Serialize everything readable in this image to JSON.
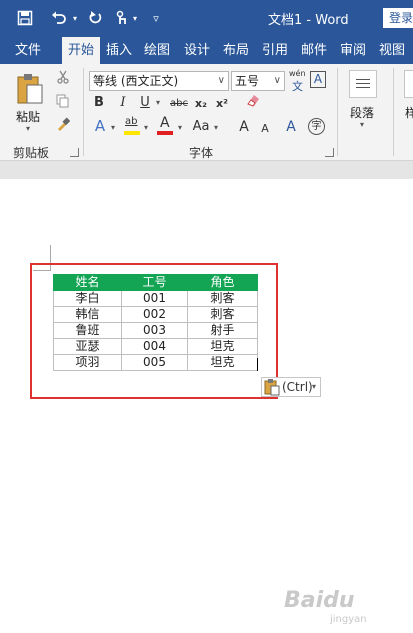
{
  "window": {
    "doc_title": "文档1 - Word",
    "login_label": "登录"
  },
  "qat": {
    "save_icon": "save-icon",
    "undo_icon": "undo-icon",
    "redo_icon": "redo-icon",
    "touch_icon": "touch-mode-icon",
    "customize_icon": "customize-qat-icon"
  },
  "tabs": [
    "文件",
    "开始",
    "插入",
    "绘图",
    "设计",
    "布局",
    "引用",
    "邮件",
    "审阅",
    "视图"
  ],
  "active_tab": "开始",
  "ribbon": {
    "clipboard": {
      "paste_label": "粘贴",
      "group_label": "剪贴板"
    },
    "font": {
      "font_name": "等线 (西文正文)",
      "font_size": "五号",
      "phonetic_top": "wén",
      "phonetic_bottom": "文",
      "border_char": "A",
      "bold": "B",
      "italic": "I",
      "underline": "U",
      "strike": "abc",
      "subscript": "x₂",
      "superscript": "x²",
      "highlight": "ab",
      "font_color": "A",
      "change_case": "Aa",
      "grow": "A",
      "shrink": "A",
      "enclose": "字",
      "text_effects": "A",
      "group_label": "字体"
    },
    "paragraph": {
      "label": "段落"
    },
    "styles": {
      "label": "样"
    }
  },
  "table": {
    "headers": [
      "姓名",
      "工号",
      "角色"
    ],
    "rows": [
      [
        "李白",
        "001",
        "刺客"
      ],
      [
        "韩信",
        "002",
        "刺客"
      ],
      [
        "鲁班",
        "003",
        "射手"
      ],
      [
        "亚瑟",
        "004",
        "坦克"
      ],
      [
        "项羽",
        "005",
        "坦克"
      ]
    ]
  },
  "paste_options": {
    "label": "(Ctrl)"
  },
  "colors": {
    "word_blue": "#2b579a",
    "table_header": "#13a454",
    "annotation_red": "#e03131"
  },
  "watermark": {
    "text": "Baidu",
    "sub": "jingyan"
  }
}
